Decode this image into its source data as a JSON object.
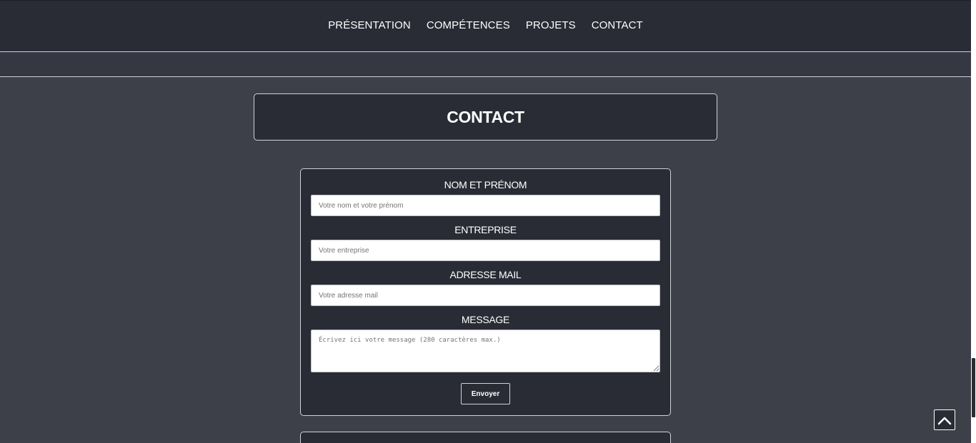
{
  "nav": {
    "items": [
      "PRÉSENTATION",
      "COMPÉTENCES",
      "PROJETS",
      "CONTACT"
    ]
  },
  "section": {
    "title": "CONTACT"
  },
  "form": {
    "name_label": "NOM ET PRÉNOM",
    "name_placeholder": "Votre nom et votre prénom",
    "company_label": "ENTREPRISE",
    "company_placeholder": "Votre entreprise",
    "email_label": "ADRESSE MAIL",
    "email_placeholder": "Votre adresse mail",
    "message_label": "MESSAGE",
    "message_placeholder": "Écrivez ici votre message (280 caractères max.)",
    "submit_label": "Envoyer"
  },
  "icons": {
    "scroll_top": "chevron-up-icon"
  },
  "colors": {
    "page_bg": "#3d4049",
    "nav_bg": "#292c35",
    "card_bg": "#292c35",
    "border": "#cfd2d8",
    "text": "#ffffff"
  }
}
